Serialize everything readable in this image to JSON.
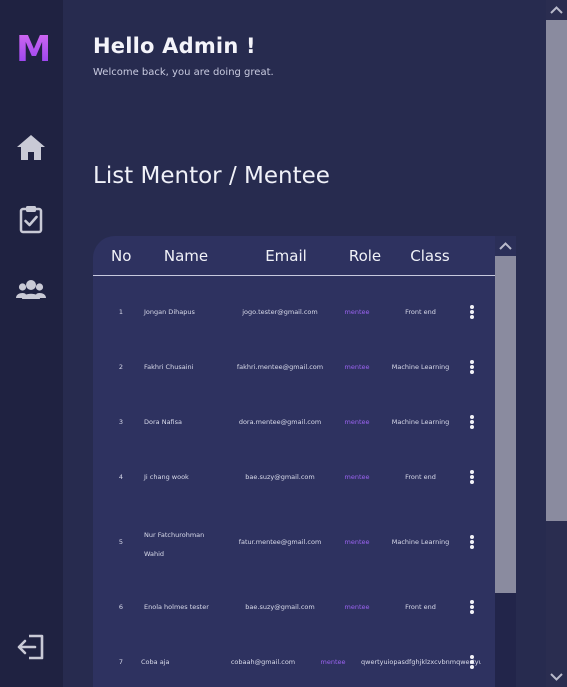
{
  "sidebar": {
    "logo": "M",
    "items": [
      {
        "name": "home",
        "icon": "home-icon"
      },
      {
        "name": "tasks",
        "icon": "clipboard-check-icon"
      },
      {
        "name": "mentees",
        "icon": "users-icon"
      }
    ],
    "logout_icon": "logout-icon"
  },
  "header": {
    "greeting": "Hello Admin !",
    "subtitle": "Welcome back, you are doing great."
  },
  "section": {
    "title": "List Mentor / Mentee"
  },
  "table": {
    "columns": [
      "No",
      "Name",
      "Email",
      "Role",
      "Class"
    ],
    "rows": [
      {
        "no": "1",
        "name": "Jongan Dihapus",
        "email": "jogo.tester@gmail.com",
        "role": "mentee",
        "class": "Front end"
      },
      {
        "no": "2",
        "name": "Fakhri Chusaini",
        "email": "fakhri.mentee@gmail.com",
        "role": "mentee",
        "class": "Machine Learning"
      },
      {
        "no": "3",
        "name": "Dora Nafisa",
        "email": "dora.mentee@gmail.com",
        "role": "mentee",
        "class": "Machine Learning"
      },
      {
        "no": "4",
        "name": "Ji chang wook",
        "email": "bae.suzy@gmail.com",
        "role": "mentee",
        "class": "Front end"
      },
      {
        "no": "5",
        "name": "Nur Fatchurohman Wahid",
        "email": "fatur.mentee@gmail.com",
        "role": "mentee",
        "class": "Machine Learning"
      },
      {
        "no": "6",
        "name": "Enola holmes tester",
        "email": "bae.suzy@gmail.com",
        "role": "mentee",
        "class": "Front end"
      },
      {
        "no": "7",
        "name": "Coba aja",
        "email": "cobaah@gmail.com",
        "role": "mentee",
        "class": "qwertyuiopasdfghjklzxcvbnmqwertyuio"
      }
    ]
  },
  "colors": {
    "background": "#272b4f",
    "sidebar": "#1f2241",
    "table_panel": "#2e3260",
    "role_accent": "#9b63f0",
    "logo_gradient_start": "#d46bf0",
    "logo_gradient_end": "#8f3df0"
  }
}
